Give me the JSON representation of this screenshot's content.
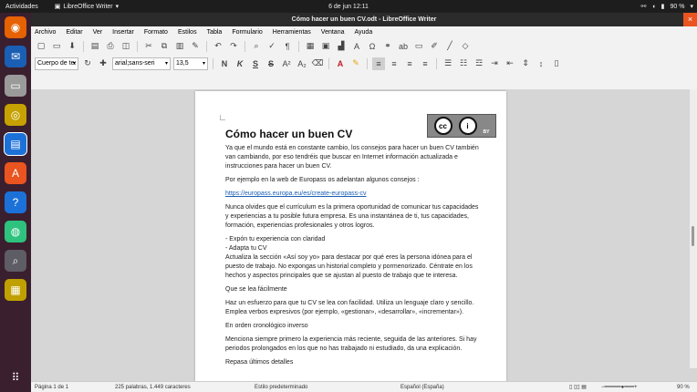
{
  "system": {
    "activities": "Actividades",
    "app_name": "LibreOffice Writer",
    "clock": "6 de jun  12:11",
    "battery": "90 %"
  },
  "window": {
    "title": "Cómo hacer un buen CV.odt - LibreOffice Writer"
  },
  "menu": [
    "Archivo",
    "Editar",
    "Ver",
    "Insertar",
    "Formato",
    "Estilos",
    "Tabla",
    "Formulario",
    "Herramientas",
    "Ventana",
    "Ayuda"
  ],
  "toolbar2": {
    "paragraph_style": "Cuerpo de te:",
    "font_name": "arial;sans-seri",
    "font_size": "13,5"
  },
  "document": {
    "heading": "Cómo hacer un buen CV",
    "license_badge": "BY",
    "paragraphs": [
      "Ya que el mundo está en constante cambio, los consejos para hacer un buen CV también van cambiando, por eso tendréis que buscar en Internet información actualizada e instrucciones para hacer un buen CV.",
      "Por ejemplo en la web de Europass os adelantan algunos consejos :",
      "https://europass.europa.eu/es/create-europass-cv",
      "Nunca olvides que el currículum es la primera oportunidad de comunicar tus capacidades y experiencias a tu posible futura empresa. Es una instantánea de ti, tus capacidades, formación, experiencias profesionales y otros logros.",
      "- Expón tu experiencia con claridad",
      "- Adapta tu CV",
      "Actualiza la sección «Así soy yo» para destacar por qué eres la persona idónea para el puesto de trabajo. No expongas un historial completo y pormenorizado. Céntrate en los hechos y aspectos principales que se ajustan al puesto de trabajo que te interesa.",
      "Que se lea fácilmente",
      "Haz un esfuerzo para que tu CV se lea con facilidad. Utiliza un lenguaje claro y sencillo. Emplea verbos expresivos (por ejemplo, «gestionar», «desarrollar», «incrementar»).",
      "En orden cronológico inverso",
      "Menciona siempre primero la experiencia más reciente, seguida de las anteriores. Si hay periodos prolongados en los que no has trabajado ni estudiado, da una explicación.",
      "Repasa últimos detalles"
    ]
  },
  "statusbar": {
    "page": "Página 1 de 1",
    "words": "225 palabras, 1.449 caracteres",
    "style": "Estilo predeterminado",
    "language": "Español (España)",
    "zoom": "90 %"
  }
}
